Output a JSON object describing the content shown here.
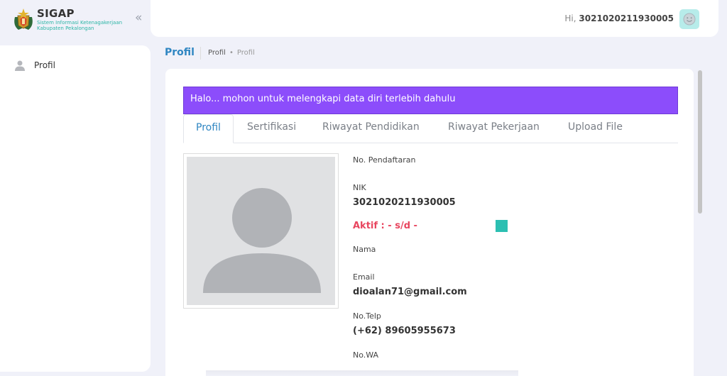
{
  "brand": {
    "title": "SIGAP",
    "subtitle": "Sistem Informasi Ketenagakerjaan Kabupaten Pekalongan"
  },
  "header": {
    "greeting": "Hi,",
    "username": "3021020211930005"
  },
  "sidebar": {
    "items": [
      {
        "label": "Profil",
        "icon": "user-icon"
      }
    ]
  },
  "breadcrumb": {
    "title": "Profil",
    "items": [
      "Profil",
      "Profil"
    ]
  },
  "alert": {
    "message": "Halo... mohon untuk melengkapi data diri terlebih dahulu"
  },
  "tabs": [
    {
      "label": "Profil",
      "active": true
    },
    {
      "label": "Sertifikasi"
    },
    {
      "label": "Riwayat Pendidikan"
    },
    {
      "label": "Riwayat Pekerjaan"
    },
    {
      "label": "Upload File"
    }
  ],
  "profile": {
    "fields": {
      "no_pendaftaran": {
        "label": "No. Pendaftaran",
        "value": ""
      },
      "nik": {
        "label": "NIK",
        "value": "3021020211930005"
      },
      "aktif": "Aktif : - s/d -",
      "nama": {
        "label": "Nama",
        "value": ""
      },
      "email": {
        "label": "Email",
        "value": "dioalan71@gmail.com"
      },
      "telp": {
        "label": "No.Telp",
        "value": "(+62) 89605955673"
      },
      "wa": {
        "label": "No.WA",
        "value": ""
      }
    }
  },
  "colors": {
    "accent": "#2f86c2",
    "alert_bg": "#8c4dfb",
    "status_red": "#e8465f",
    "teal": "#2cbfb2"
  }
}
